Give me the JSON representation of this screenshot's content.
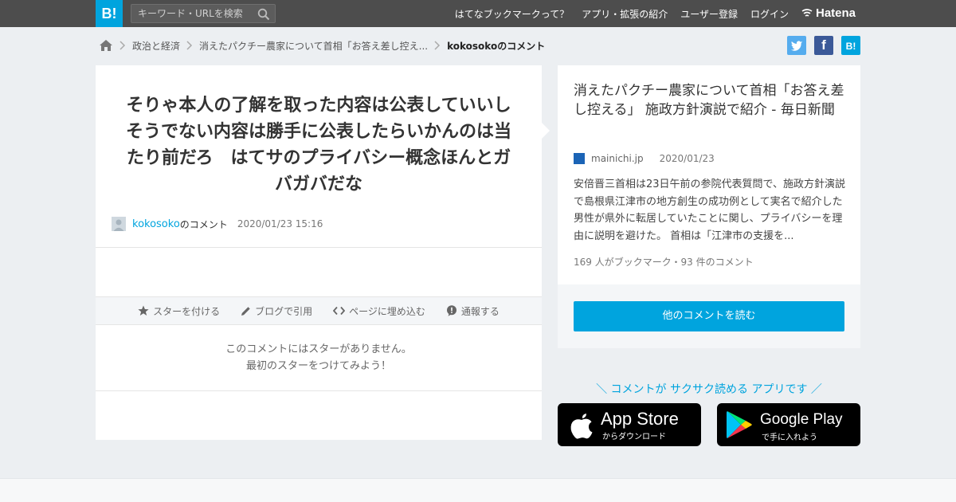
{
  "header": {
    "logo": "B!",
    "search_placeholder": "キーワード・URLを検索",
    "nav": [
      "はてなブックマークって？",
      "アプリ・拡張の紹介",
      "ユーザー登録",
      "ログイン"
    ],
    "brand": "Hatena"
  },
  "breadcrumb": {
    "items": [
      "政治と経済",
      "消えたパクチー農家について首相「お答え差し控え...",
      "kokosokoのコメント"
    ]
  },
  "share": {
    "twitter": "t",
    "facebook": "f",
    "hatena": "B!"
  },
  "comment": {
    "text": "そりゃ本人の了解を取った内容は公表していいしそうでない内容は勝手に公表したらいかんのは当たり前だろ　はてサのプライバシー概念ほんとガバガバだな",
    "user": "kokosoko",
    "user_suffix": "のコメント",
    "datetime": "2020/01/23 15:16"
  },
  "actions": [
    "スターを付ける",
    "ブログで引用",
    "ページに埋め込む",
    "通報する"
  ],
  "no_star": {
    "line1": "このコメントにはスターがありません。",
    "line2": "最初のスターをつけてみよう！"
  },
  "entry": {
    "title": "消えたパクチー農家について首相「お答え差し控える」 施政方針演説で紹介 - 毎日新聞",
    "domain": "mainichi.jp",
    "date": "2020/01/23",
    "description": "安倍晋三首相は23日午前の参院代表質問で、施政方針演説で島根県江津市の地方創生の成功例として実名で紹介した男性が県外に転居していたことに関し、プライバシーを理由に説明を避けた。 首相は「江津市の支援を...",
    "stats": "169 人がブックマーク・93 件のコメント",
    "read_button": "他のコメントを読む"
  },
  "promo": {
    "tagline": "＼ コメントが サクサク読める アプリです ／",
    "appstore_big": "App Store",
    "appstore_small": "からダウンロード",
    "googleplay_big": "Google Play",
    "googleplay_small": "で手に入れよう"
  },
  "colors": {
    "brand": "#00a4de",
    "topbar": "#4d4d4d",
    "background": "#eceff2"
  }
}
